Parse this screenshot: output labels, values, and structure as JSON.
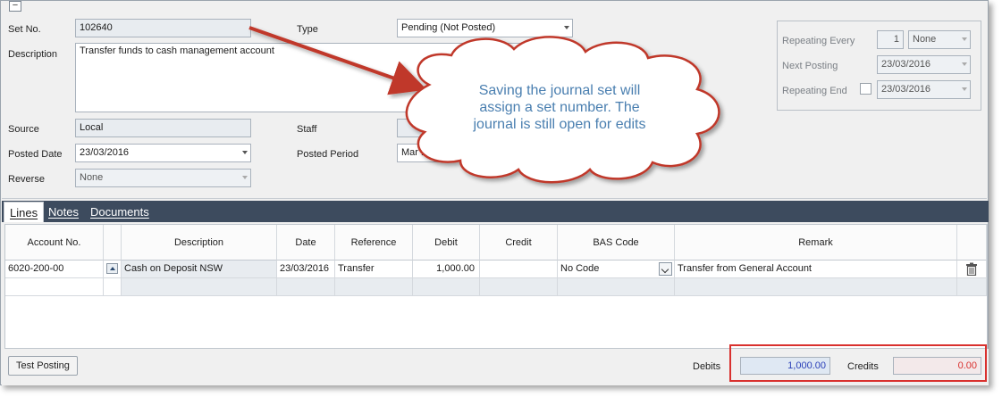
{
  "header": {
    "set_no_label": "Set No.",
    "set_no_value": "102640",
    "type_label": "Type",
    "type_value": "Pending (Not Posted)",
    "description_label": "Description",
    "description_value": "Transfer funds to cash management account",
    "source_label": "Source",
    "source_value": "Local",
    "staff_label": "Staff",
    "posted_date_label": "Posted Date",
    "posted_date_value": "23/03/2016",
    "posted_period_label": "Posted Period",
    "posted_period_value": "Mar 16",
    "reverse_label": "Reverse",
    "reverse_value": "None"
  },
  "repeating": {
    "every_label": "Repeating Every",
    "every_count": "1",
    "every_unit": "None",
    "next_label": "Next Posting",
    "next_value": "23/03/2016",
    "end_label": "Repeating End",
    "end_value": "23/03/2016"
  },
  "tabs": [
    {
      "label": "Lines",
      "active": true
    },
    {
      "label": "Notes",
      "active": false
    },
    {
      "label": "Documents",
      "active": false
    }
  ],
  "grid": {
    "columns": [
      "Account No.",
      "Description",
      "Date",
      "Reference",
      "Debit",
      "Credit",
      "BAS Code",
      "Remark"
    ],
    "rows": [
      {
        "account": "6020-200-00",
        "description": "Cash on Deposit NSW",
        "date": "23/03/2016",
        "reference": "Transfer",
        "debit": "1,000.00",
        "credit": "",
        "bas_code": "No Code",
        "remark": "Transfer from General Account"
      }
    ]
  },
  "footer": {
    "test_posting_label": "Test Posting",
    "debits_label": "Debits",
    "debits_value": "1,000.00",
    "credits_label": "Credits",
    "credits_value": "0.00"
  },
  "callout": {
    "line1": "Saving the journal set will",
    "line2": "assign a set number.  The",
    "line3": "journal is still open for edits"
  },
  "colors": {
    "debits_text": "#2a3fb8",
    "credits_text": "#d9312e",
    "highlight_box": "#d9312e",
    "arrow": "#c0392b",
    "tabbar": "#3d4b5e",
    "callout_text": "#4a7fb0"
  }
}
